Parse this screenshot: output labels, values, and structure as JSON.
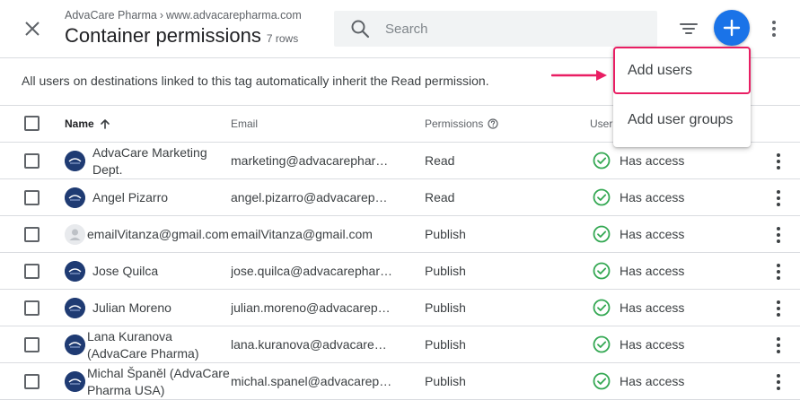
{
  "header": {
    "breadcrumb_account": "AdvaCare Pharma",
    "breadcrumb_sep": "›",
    "breadcrumb_container": "www.advacarepharma.com",
    "title": "Container permissions",
    "row_count": "7 rows",
    "search_placeholder": "Search"
  },
  "notice": "All users on destinations linked to this tag automatically inherit the Read permission.",
  "table": {
    "columns": {
      "name": "Name",
      "email": "Email",
      "permissions": "Permissions",
      "user": "User"
    },
    "rows": [
      {
        "name": "AdvaCare Marketing Dept.",
        "email": "marketing@advacarephar…",
        "permission": "Read",
        "status": "Has access",
        "avatar": "logo"
      },
      {
        "name": "Angel Pizarro",
        "email": "angel.pizarro@advacareph…",
        "permission": "Read",
        "status": "Has access",
        "avatar": "logo"
      },
      {
        "name": "emailVitanza@gmail.com",
        "email": "emailVitanza@gmail.com",
        "permission": "Publish",
        "status": "Has access",
        "avatar": "generic"
      },
      {
        "name": "Jose Quilca",
        "email": "jose.quilca@advacarephar…",
        "permission": "Publish",
        "status": "Has access",
        "avatar": "logo"
      },
      {
        "name": "Julian Moreno",
        "email": "julian.moreno@advacareph…",
        "permission": "Publish",
        "status": "Has access",
        "avatar": "logo"
      },
      {
        "name": "Lana Kuranova (AdvaCare Pharma)",
        "email": "lana.kuranova@advacarep…",
        "permission": "Publish",
        "status": "Has access",
        "avatar": "logo"
      },
      {
        "name": "Michal Španěl (AdvaCare Pharma USA)",
        "email": "michal.spanel@advacarep…",
        "permission": "Publish",
        "status": "Has access",
        "avatar": "logo"
      }
    ]
  },
  "add_menu": {
    "items": [
      {
        "label": "Add users"
      },
      {
        "label": "Add user groups"
      }
    ]
  },
  "colors": {
    "accent": "#1a73e8",
    "highlight": "#e91e63",
    "success": "#34a853"
  }
}
